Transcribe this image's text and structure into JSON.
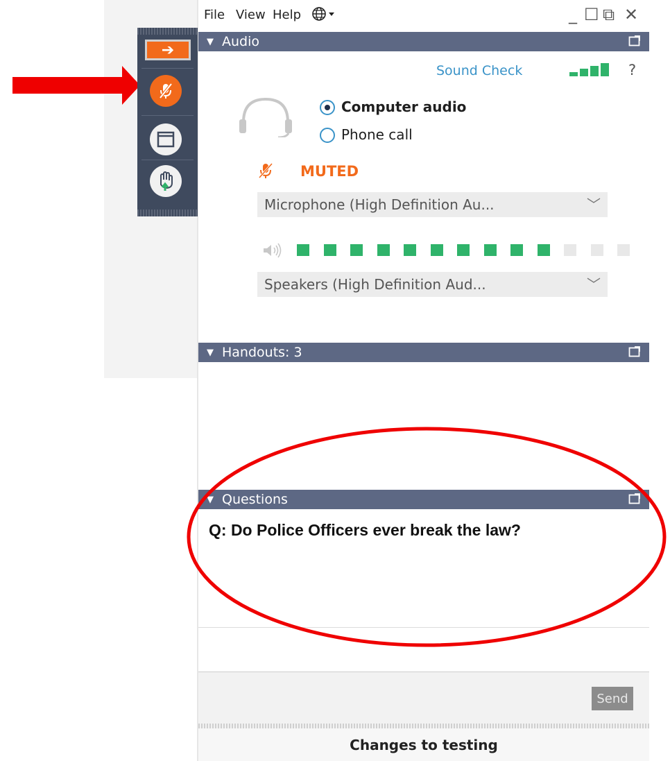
{
  "menu": {
    "file": "File",
    "view": "View",
    "help": "Help",
    "language_icon": "globe-icon"
  },
  "window_controls": {
    "minimize": "_",
    "maximize": "☐",
    "popout": "⧉",
    "close": "✕"
  },
  "toolbar": {
    "items": [
      "arrow-right-icon",
      "microphone-muted-icon",
      "window-icon",
      "raise-hand-icon"
    ]
  },
  "audio": {
    "header": "Audio",
    "sound_check": "Sound Check",
    "help": "?",
    "options": [
      "Computer audio",
      "Phone call"
    ],
    "selected_option": "Computer audio",
    "status": "MUTED",
    "microphone": "Microphone (High Definition Au...",
    "speakers": "Speakers (High Definition Aud...",
    "speaker_level_fraction": 0.77,
    "colors": {
      "accent": "#3a93c8",
      "muted": "#f26a1b",
      "level_on": "#2fb36a",
      "level_off": "#e8e8e8"
    }
  },
  "handouts": {
    "header": "Handouts: 3"
  },
  "questions": {
    "header": "Questions",
    "question": "Q: Do Police Officers ever break the law?",
    "send_label": "Send"
  },
  "footer": {
    "title": "Changes to testing"
  },
  "annotation_colors": {
    "red": "#ef0000"
  }
}
